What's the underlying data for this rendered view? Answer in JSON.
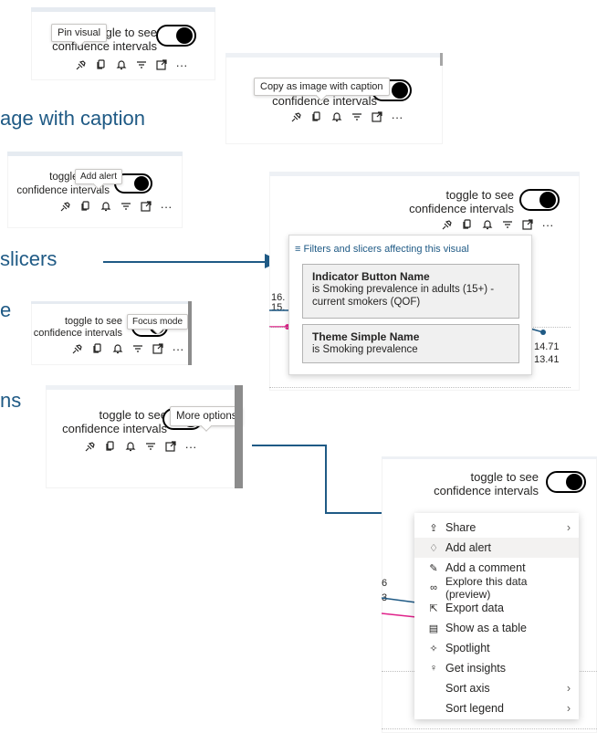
{
  "toggle_text_line1": "toggle to see",
  "toggle_text_line2": "confidence intervals",
  "tooltips": {
    "pin": "Pin visual",
    "copy": "Copy as image with caption",
    "alert": "Add alert",
    "focus": "Focus mode",
    "more": "More options"
  },
  "partial_labels": {
    "copy": "age with caption",
    "filters": "slicers",
    "focus": "e",
    "more": "ns"
  },
  "filters_panel": {
    "header": "Filters and slicers affecting this visual",
    "cards": [
      {
        "name": "Indicator Button Name",
        "value": "is Smoking prevalence in adults (15+) - current smokers (QOF)"
      },
      {
        "name": "Theme Simple Name",
        "value": "is Smoking prevalence"
      }
    ],
    "bg_values": {
      "left_top": "16.",
      "left_bottom": "15.",
      "right_top": "14.71",
      "right_bottom": "13.41"
    }
  },
  "more_menu": {
    "items": [
      {
        "icon": "share-icon",
        "glyph": "⇪",
        "label": "Share",
        "submenu": true
      },
      {
        "icon": "bell-icon",
        "glyph": "♢",
        "label": "Add alert",
        "submenu": false,
        "hover": true
      },
      {
        "icon": "comment-icon",
        "glyph": "✎",
        "label": "Add a comment",
        "submenu": false
      },
      {
        "icon": "binoculars-icon",
        "glyph": "∞",
        "label": "Explore this data (preview)",
        "submenu": false
      },
      {
        "icon": "export-icon",
        "glyph": "⇱",
        "label": "Export data",
        "submenu": false
      },
      {
        "icon": "table-icon",
        "glyph": "▤",
        "label": "Show as a table",
        "submenu": false
      },
      {
        "icon": "spotlight-icon",
        "glyph": "✧",
        "label": "Spotlight",
        "submenu": false
      },
      {
        "icon": "lightbulb-icon",
        "glyph": "♀",
        "label": "Get insights",
        "submenu": false
      },
      {
        "icon": "",
        "glyph": "",
        "label": "Sort axis",
        "submenu": true
      },
      {
        "icon": "",
        "glyph": "",
        "label": "Sort legend",
        "submenu": true
      }
    ],
    "bg_values": {
      "left_top": "6",
      "left_bottom": "3"
    }
  },
  "colors": {
    "accent": "#1f5a85",
    "series_blue": "#1f5a85",
    "series_pink": "#e0218a"
  }
}
